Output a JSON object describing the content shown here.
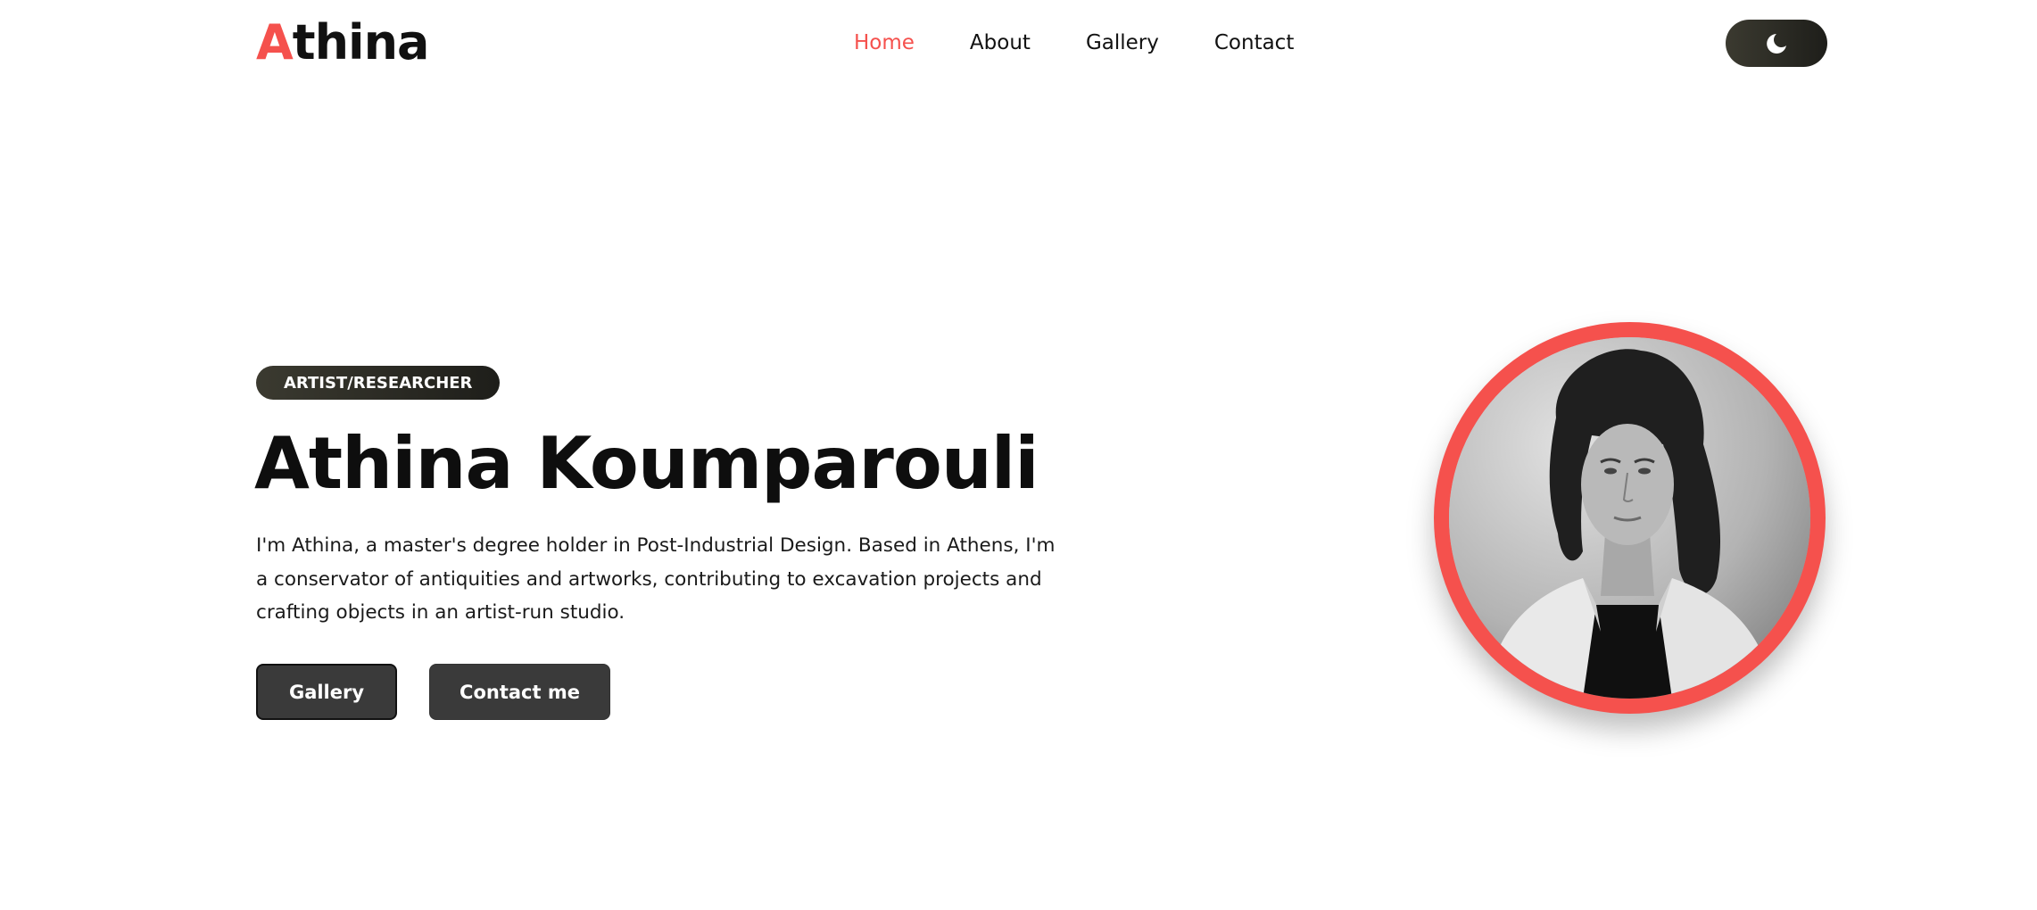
{
  "header": {
    "logo_first": "A",
    "logo_rest": "thina",
    "nav": [
      {
        "label": "Home",
        "active": true
      },
      {
        "label": "About",
        "active": false
      },
      {
        "label": "Gallery",
        "active": false
      },
      {
        "label": "Contact",
        "active": false
      }
    ],
    "theme_toggle_icon": "moon-icon"
  },
  "hero": {
    "badge": "ARTIST/RESEARCHER",
    "title": "Athina Koumparouli",
    "description": "I'm Athina, a master's degree holder in Post-Industrial Design. Based in Athens, I'm a conservator of antiquities and artworks, contributing to excavation projects and crafting objects in an artist-run studio.",
    "buttons": {
      "gallery": "Gallery",
      "contact": "Contact me"
    }
  },
  "colors": {
    "accent": "#f5514d",
    "dark": "#2e2d27"
  }
}
